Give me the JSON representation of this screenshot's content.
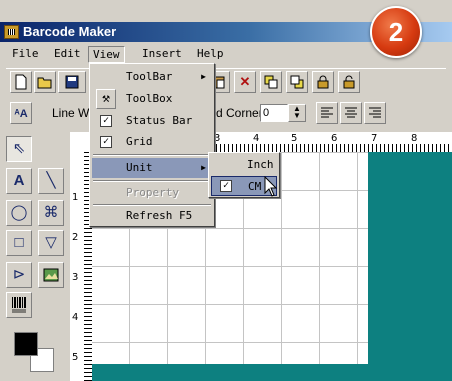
{
  "window": {
    "title": "Barcode Maker"
  },
  "badge": {
    "number": "2",
    "color": "#d63a10"
  },
  "menubar": {
    "items": [
      {
        "label": "File"
      },
      {
        "label": "Edit"
      },
      {
        "label": "View"
      },
      {
        "label": "Insert"
      },
      {
        "label": "Help"
      }
    ]
  },
  "toolbar2": {
    "line_label": "Line W",
    "corner_label": "d Corner:",
    "corner_value": "0"
  },
  "view_menu": {
    "items": [
      {
        "label": "ToolBar",
        "submenu": true
      },
      {
        "label": "ToolBox",
        "icon": "toolbox-icon"
      },
      {
        "label": "Status Bar",
        "checked": true
      },
      {
        "label": "Grid",
        "checked": true
      },
      {
        "label": "Unit",
        "submenu": true,
        "highlighted": true
      },
      {
        "label": "Property",
        "disabled": true
      },
      {
        "label": "Refresh  F5"
      }
    ]
  },
  "unit_menu": {
    "items": [
      {
        "label": "Inch"
      },
      {
        "label": "CM",
        "checked": true,
        "highlighted": true
      }
    ]
  },
  "ruler": {
    "top_numbers": [
      "3",
      "4",
      "5",
      "6",
      "7",
      "8"
    ],
    "left_numbers": [
      "1",
      "2",
      "3",
      "4",
      "5"
    ]
  },
  "colors": {
    "workspace": "#0d8080",
    "menu_highlight": "#8a98b8",
    "foreground_swatch": "#000000",
    "background_swatch": "#ffffff"
  }
}
